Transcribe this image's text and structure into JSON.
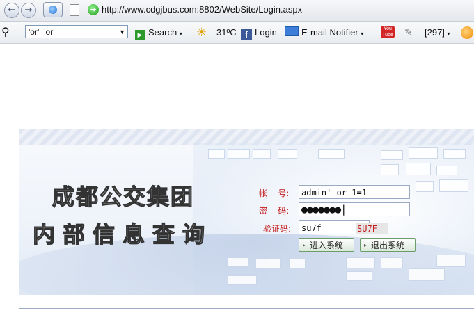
{
  "browser": {
    "url": "http://www.cdgjbus.com:8802/WebSite/Login.aspx"
  },
  "toolbar": {
    "search_value": "'or'='or'",
    "search_label": "Search",
    "weather": "31ºC",
    "facebook_label": "Login",
    "email_label": "E-mail Notifier",
    "counter": "[297]",
    "youtube_text": [
      "You",
      "Tube"
    ]
  },
  "login": {
    "title_line1": "成都公交集团",
    "title_line2": "内部信息查询",
    "account_label": "帐    号:",
    "account_value": "admin' or 1=1--",
    "password_label": "密    码:",
    "password_value": "●●●●●●●|",
    "captcha_label": "验证码:",
    "captcha_value": "su7f",
    "captcha_image_text": "SU7F",
    "enter_button": "进入系统",
    "exit_button": "退出系统"
  },
  "colors": {
    "label_red": "#c41a1a",
    "banner_blue": "#e9eff8",
    "button_border": "#6a9d6a"
  },
  "icons": [
    "back-arrow-icon",
    "forward-arrow-icon",
    "home-icon",
    "page-icon",
    "go-icon",
    "search-magnifier-icon",
    "search-go-icon",
    "weather-sun-icon",
    "facebook-icon",
    "email-icon",
    "youtube-icon",
    "counter-icon",
    "orange-circle-icon"
  ]
}
